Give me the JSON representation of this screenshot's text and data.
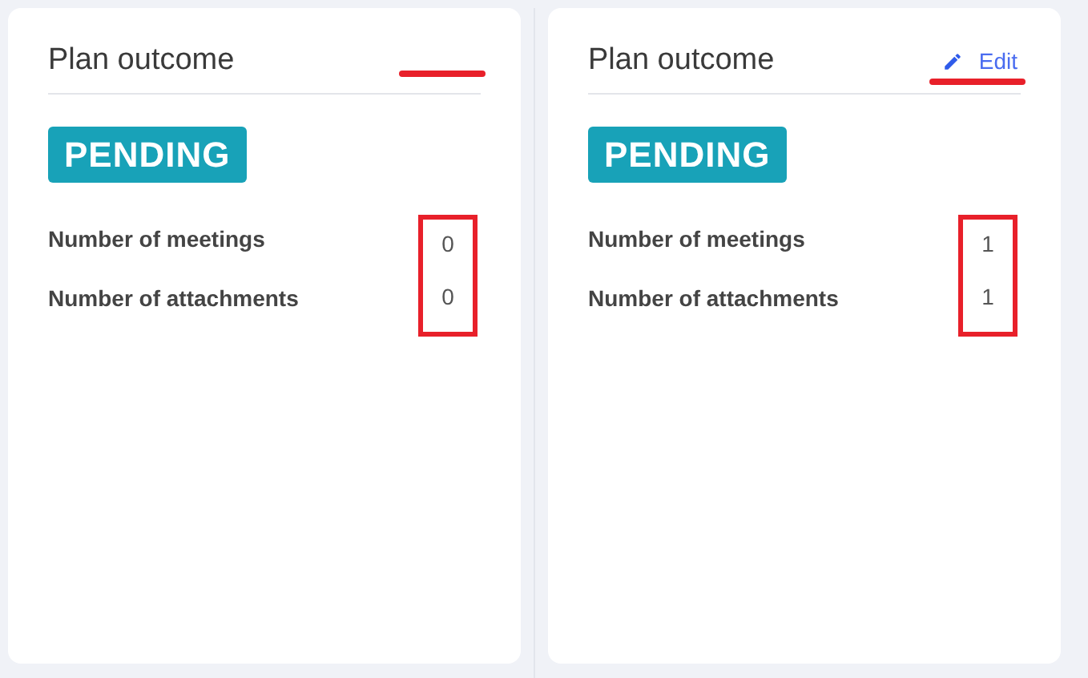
{
  "panels": [
    {
      "title": "Plan outcome",
      "status": "PENDING",
      "header_underlined": true,
      "values_boxed": true,
      "stats": [
        {
          "label": "Number of meetings",
          "value": "0"
        },
        {
          "label": "Number of attachments",
          "value": "0"
        }
      ]
    },
    {
      "title": "Plan outcome",
      "edit": {
        "label": "Edit"
      },
      "status": "PENDING",
      "header_underlined": true,
      "values_boxed": true,
      "stats": [
        {
          "label": "Number of meetings",
          "value": "1"
        },
        {
          "label": "Number of attachments",
          "value": "1"
        }
      ]
    }
  ]
}
